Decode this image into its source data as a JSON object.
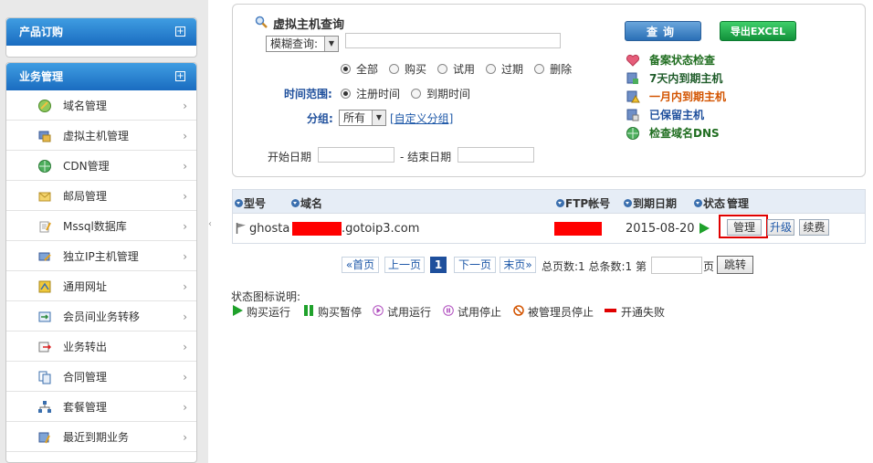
{
  "sidebar": {
    "panels": {
      "orders": {
        "title": "产品订购"
      },
      "business": {
        "title": "业务管理"
      }
    },
    "items": [
      {
        "label": "域名管理",
        "icon": "domain-icon"
      },
      {
        "label": "虚拟主机管理",
        "icon": "vhost-icon"
      },
      {
        "label": "CDN管理",
        "icon": "cdn-icon"
      },
      {
        "label": "邮局管理",
        "icon": "mail-icon"
      },
      {
        "label": "Mssql数据库",
        "icon": "database-icon"
      },
      {
        "label": "独立IP主机管理",
        "icon": "ip-host-icon"
      },
      {
        "label": "通用网址",
        "icon": "url-icon"
      },
      {
        "label": "会员间业务转移",
        "icon": "transfer-icon"
      },
      {
        "label": "业务转出",
        "icon": "transfer-out-icon"
      },
      {
        "label": "合同管理",
        "icon": "contract-icon"
      },
      {
        "label": "套餐管理",
        "icon": "package-icon"
      },
      {
        "label": "最近到期业务",
        "icon": "expiring-icon"
      }
    ]
  },
  "search": {
    "title": "虚拟主机查询",
    "mode_select": "模糊查询:",
    "keyword_value": "",
    "status_options": [
      "全部",
      "购买",
      "试用",
      "过期",
      "删除"
    ],
    "status_selected": 0,
    "time_range_label": "时间范围:",
    "time_options": [
      "注册时间",
      "到期时间"
    ],
    "time_selected": 0,
    "group_label": "分组:",
    "group_value": "所有",
    "custom_group_link": "[自定义分组]",
    "start_date_label": "开始日期",
    "end_date_label": "- 结束日期",
    "query_button": "查询",
    "export_button": "导出EXCEL",
    "quick_links": [
      {
        "label": "备案状态检查",
        "color": "#1f6d1f",
        "icon": "heart-icon"
      },
      {
        "label": "7天内到期主机",
        "color": "#1f5c2a",
        "icon": "server-icon"
      },
      {
        "label": "一月内到期主机",
        "color": "#d35400",
        "icon": "warning-server-icon"
      },
      {
        "label": "已保留主机",
        "color": "#1e4f9c",
        "icon": "saved-server-icon"
      },
      {
        "label": "检查域名DNS",
        "color": "#1f6d1f",
        "icon": "globe-icon"
      }
    ]
  },
  "table": {
    "headers": {
      "model": "型号",
      "domain": "域名",
      "ftp": "FTP帐号",
      "expire": "到期日期",
      "status": "状态",
      "manage": "管理"
    },
    "rows": [
      {
        "model": "ghosta",
        "domain_suffix": ".gotoip3.com",
        "expire": "2015-08-20",
        "manage_label": "管理",
        "upgrade_label": "升级",
        "renew_label": "续费"
      }
    ]
  },
  "pager": {
    "first": "«首页",
    "prev": "上一页",
    "current": "1",
    "next": "下一页",
    "last": "末页»",
    "summary": "总页数:1 总条数:1 第",
    "page_unit": "页",
    "jump": "跳转"
  },
  "legend": {
    "title": "状态图标说明:",
    "items": [
      {
        "label": "购买运行",
        "color": "#1fa12b"
      },
      {
        "label": "购买暂停",
        "color": "#1fa12b"
      },
      {
        "label": "试用运行",
        "color": "#b04fbf"
      },
      {
        "label": "试用停止",
        "color": "#b04fbf"
      },
      {
        "label": "被管理员停止",
        "color": "#d35400"
      },
      {
        "label": "开通失败",
        "color": "#e00000"
      }
    ]
  },
  "colors": {
    "redact": "#ff0000",
    "highlight": "#e00000",
    "link": "#1e58a8"
  }
}
